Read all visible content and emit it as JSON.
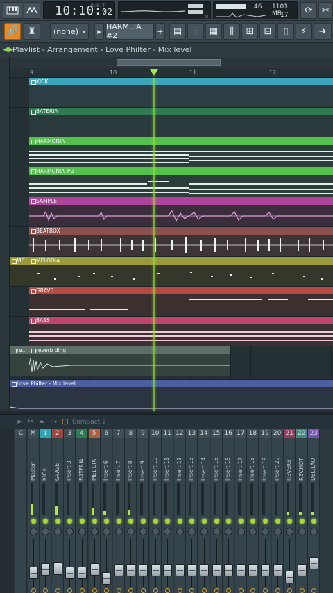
{
  "toolbar": {
    "time_main": "10:10:",
    "time_sec": "02",
    "time_tiny": "B:S:T",
    "cpu_value": "46",
    "memory": "1101 MB",
    "polyphony": "17",
    "pattern_select": "(none)",
    "pattern_name": "HARM..IA #2",
    "add_label": "+",
    "icons": [
      "keyboard-icon",
      "metronome-icon",
      "undo-icon",
      "cut-icon",
      "snap-icon",
      "mixer-icon",
      "channel-rack-icon",
      "piano-roll-icon",
      "browser-icon",
      "plugin-icon",
      "settings-icon"
    ]
  },
  "titlebar": {
    "text": "Playlist - Arrangement  ›  Love Philter - Mix level"
  },
  "ruler": {
    "bars": [
      "9",
      "10",
      "11",
      "12"
    ]
  },
  "playlist": {
    "tracks": [
      {
        "name": "KICK",
        "color": "#3aa6b9"
      },
      {
        "name": "BATERIA",
        "color": "#2f7a52"
      },
      {
        "name": "HARMONIA",
        "color": "#55c14d"
      },
      {
        "name": "HARMONIA #2",
        "color": "#55c14d"
      },
      {
        "name": "SAMPLE",
        "color": "#b0449d"
      },
      {
        "name": "BEATBOX",
        "color": "#8b4f4f"
      },
      {
        "name": "MELODIA",
        "color": "#9a9a3c",
        "prefix": "ME..."
      },
      {
        "name": "GRAVE",
        "color": "#b34a43"
      },
      {
        "name": "BASS",
        "color": "#c0456a"
      },
      {
        "name": "reverb ding",
        "color": "#5d6f66",
        "prefix": "re..."
      }
    ],
    "automation": {
      "name": "Love Philter - Mix level",
      "color": "#4a5ea0"
    }
  },
  "mixer": {
    "preset": "Compact 2",
    "strips": [
      {
        "num": "C",
        "name": "",
        "color": "#3f4d54"
      },
      {
        "num": "M",
        "name": "Master",
        "color": "#3f4d54",
        "level": 0.35
      },
      {
        "num": "1",
        "name": "KICK",
        "color": "#2aa7b7",
        "level": 0.0
      },
      {
        "num": "2",
        "name": "GRAVE",
        "color": "#a3433c",
        "level": 0.3
      },
      {
        "num": "3",
        "name": "Insert 3",
        "color": "#3f4d54",
        "level": 0
      },
      {
        "num": "4",
        "name": "BATERIA",
        "color": "#2f7a52",
        "level": 0
      },
      {
        "num": "5",
        "name": "MEL.DIA",
        "color": "#b55c3a",
        "level": 0.25
      },
      {
        "num": "6",
        "name": "Insert 6",
        "color": "#3f4d54",
        "level": 0.12
      },
      {
        "num": "7",
        "name": "Insert 7",
        "color": "#3f4d54",
        "level": 0
      },
      {
        "num": "8",
        "name": "Insert 8",
        "color": "#3f4d54",
        "level": 0.18
      },
      {
        "num": "9",
        "name": "Insert 9",
        "color": "#3f4d54",
        "level": 0
      },
      {
        "num": "10",
        "name": "Insert 10",
        "color": "#3f4d54",
        "level": 0
      },
      {
        "num": "11",
        "name": "Insert 11",
        "color": "#3f4d54",
        "level": 0
      },
      {
        "num": "12",
        "name": "Insert 12",
        "color": "#3f4d54",
        "level": 0
      },
      {
        "num": "13",
        "name": "Insert 13",
        "color": "#3f4d54",
        "level": 0
      },
      {
        "num": "14",
        "name": "Insert 14",
        "color": "#3f4d54",
        "level": 0
      },
      {
        "num": "15",
        "name": "Insert 15",
        "color": "#3f4d54",
        "level": 0
      },
      {
        "num": "16",
        "name": "Insert 16",
        "color": "#3f4d54",
        "level": 0
      },
      {
        "num": "17",
        "name": "Insert 17",
        "color": "#3f4d54",
        "level": 0
      },
      {
        "num": "18",
        "name": "Insert 18",
        "color": "#3f4d54",
        "level": 0
      },
      {
        "num": "19",
        "name": "Insert 19",
        "color": "#3f4d54",
        "level": 0
      },
      {
        "num": "20",
        "name": "Insert 20",
        "color": "#3f4d54",
        "level": 0
      },
      {
        "num": "21",
        "name": "REVERB",
        "color": "#9c3a5e",
        "level": 0.08
      },
      {
        "num": "22",
        "name": "REV.HOT",
        "color": "#3d8c7e",
        "level": 0.08
      },
      {
        "num": "23",
        "name": "DEL.LÃO",
        "color": "#7a4fb0",
        "level": 0.1
      }
    ]
  }
}
